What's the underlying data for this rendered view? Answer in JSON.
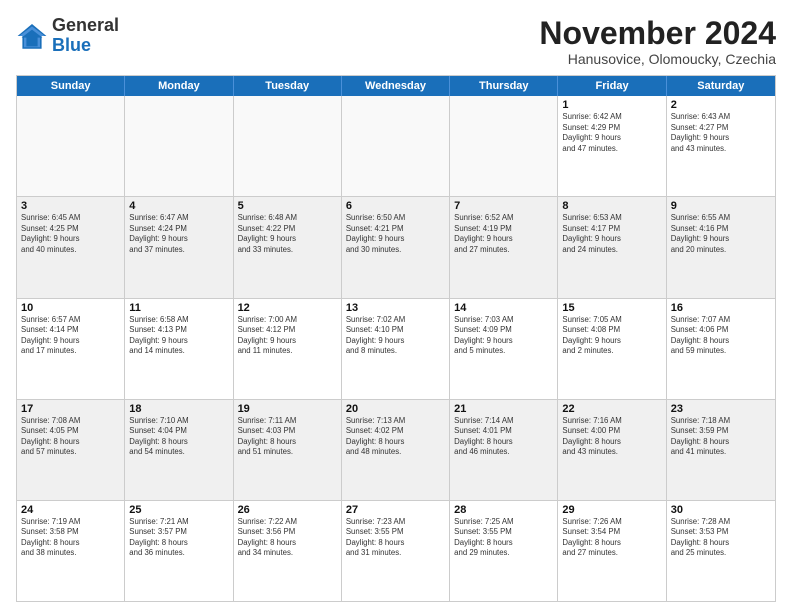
{
  "header": {
    "logo_line1": "General",
    "logo_line2": "Blue",
    "month_title": "November 2024",
    "subtitle": "Hanusovice, Olomoucky, Czechia"
  },
  "days_of_week": [
    "Sunday",
    "Monday",
    "Tuesday",
    "Wednesday",
    "Thursday",
    "Friday",
    "Saturday"
  ],
  "weeks": [
    [
      {
        "day": "",
        "info": "",
        "empty": true
      },
      {
        "day": "",
        "info": "",
        "empty": true
      },
      {
        "day": "",
        "info": "",
        "empty": true
      },
      {
        "day": "",
        "info": "",
        "empty": true
      },
      {
        "day": "",
        "info": "",
        "empty": true
      },
      {
        "day": "1",
        "info": "Sunrise: 6:42 AM\nSunset: 4:29 PM\nDaylight: 9 hours\nand 47 minutes.",
        "empty": false
      },
      {
        "day": "2",
        "info": "Sunrise: 6:43 AM\nSunset: 4:27 PM\nDaylight: 9 hours\nand 43 minutes.",
        "empty": false
      }
    ],
    [
      {
        "day": "3",
        "info": "Sunrise: 6:45 AM\nSunset: 4:25 PM\nDaylight: 9 hours\nand 40 minutes.",
        "empty": false
      },
      {
        "day": "4",
        "info": "Sunrise: 6:47 AM\nSunset: 4:24 PM\nDaylight: 9 hours\nand 37 minutes.",
        "empty": false
      },
      {
        "day": "5",
        "info": "Sunrise: 6:48 AM\nSunset: 4:22 PM\nDaylight: 9 hours\nand 33 minutes.",
        "empty": false
      },
      {
        "day": "6",
        "info": "Sunrise: 6:50 AM\nSunset: 4:21 PM\nDaylight: 9 hours\nand 30 minutes.",
        "empty": false
      },
      {
        "day": "7",
        "info": "Sunrise: 6:52 AM\nSunset: 4:19 PM\nDaylight: 9 hours\nand 27 minutes.",
        "empty": false
      },
      {
        "day": "8",
        "info": "Sunrise: 6:53 AM\nSunset: 4:17 PM\nDaylight: 9 hours\nand 24 minutes.",
        "empty": false
      },
      {
        "day": "9",
        "info": "Sunrise: 6:55 AM\nSunset: 4:16 PM\nDaylight: 9 hours\nand 20 minutes.",
        "empty": false
      }
    ],
    [
      {
        "day": "10",
        "info": "Sunrise: 6:57 AM\nSunset: 4:14 PM\nDaylight: 9 hours\nand 17 minutes.",
        "empty": false
      },
      {
        "day": "11",
        "info": "Sunrise: 6:58 AM\nSunset: 4:13 PM\nDaylight: 9 hours\nand 14 minutes.",
        "empty": false
      },
      {
        "day": "12",
        "info": "Sunrise: 7:00 AM\nSunset: 4:12 PM\nDaylight: 9 hours\nand 11 minutes.",
        "empty": false
      },
      {
        "day": "13",
        "info": "Sunrise: 7:02 AM\nSunset: 4:10 PM\nDaylight: 9 hours\nand 8 minutes.",
        "empty": false
      },
      {
        "day": "14",
        "info": "Sunrise: 7:03 AM\nSunset: 4:09 PM\nDaylight: 9 hours\nand 5 minutes.",
        "empty": false
      },
      {
        "day": "15",
        "info": "Sunrise: 7:05 AM\nSunset: 4:08 PM\nDaylight: 9 hours\nand 2 minutes.",
        "empty": false
      },
      {
        "day": "16",
        "info": "Sunrise: 7:07 AM\nSunset: 4:06 PM\nDaylight: 8 hours\nand 59 minutes.",
        "empty": false
      }
    ],
    [
      {
        "day": "17",
        "info": "Sunrise: 7:08 AM\nSunset: 4:05 PM\nDaylight: 8 hours\nand 57 minutes.",
        "empty": false
      },
      {
        "day": "18",
        "info": "Sunrise: 7:10 AM\nSunset: 4:04 PM\nDaylight: 8 hours\nand 54 minutes.",
        "empty": false
      },
      {
        "day": "19",
        "info": "Sunrise: 7:11 AM\nSunset: 4:03 PM\nDaylight: 8 hours\nand 51 minutes.",
        "empty": false
      },
      {
        "day": "20",
        "info": "Sunrise: 7:13 AM\nSunset: 4:02 PM\nDaylight: 8 hours\nand 48 minutes.",
        "empty": false
      },
      {
        "day": "21",
        "info": "Sunrise: 7:14 AM\nSunset: 4:01 PM\nDaylight: 8 hours\nand 46 minutes.",
        "empty": false
      },
      {
        "day": "22",
        "info": "Sunrise: 7:16 AM\nSunset: 4:00 PM\nDaylight: 8 hours\nand 43 minutes.",
        "empty": false
      },
      {
        "day": "23",
        "info": "Sunrise: 7:18 AM\nSunset: 3:59 PM\nDaylight: 8 hours\nand 41 minutes.",
        "empty": false
      }
    ],
    [
      {
        "day": "24",
        "info": "Sunrise: 7:19 AM\nSunset: 3:58 PM\nDaylight: 8 hours\nand 38 minutes.",
        "empty": false
      },
      {
        "day": "25",
        "info": "Sunrise: 7:21 AM\nSunset: 3:57 PM\nDaylight: 8 hours\nand 36 minutes.",
        "empty": false
      },
      {
        "day": "26",
        "info": "Sunrise: 7:22 AM\nSunset: 3:56 PM\nDaylight: 8 hours\nand 34 minutes.",
        "empty": false
      },
      {
        "day": "27",
        "info": "Sunrise: 7:23 AM\nSunset: 3:55 PM\nDaylight: 8 hours\nand 31 minutes.",
        "empty": false
      },
      {
        "day": "28",
        "info": "Sunrise: 7:25 AM\nSunset: 3:55 PM\nDaylight: 8 hours\nand 29 minutes.",
        "empty": false
      },
      {
        "day": "29",
        "info": "Sunrise: 7:26 AM\nSunset: 3:54 PM\nDaylight: 8 hours\nand 27 minutes.",
        "empty": false
      },
      {
        "day": "30",
        "info": "Sunrise: 7:28 AM\nSunset: 3:53 PM\nDaylight: 8 hours\nand 25 minutes.",
        "empty": false
      }
    ]
  ]
}
